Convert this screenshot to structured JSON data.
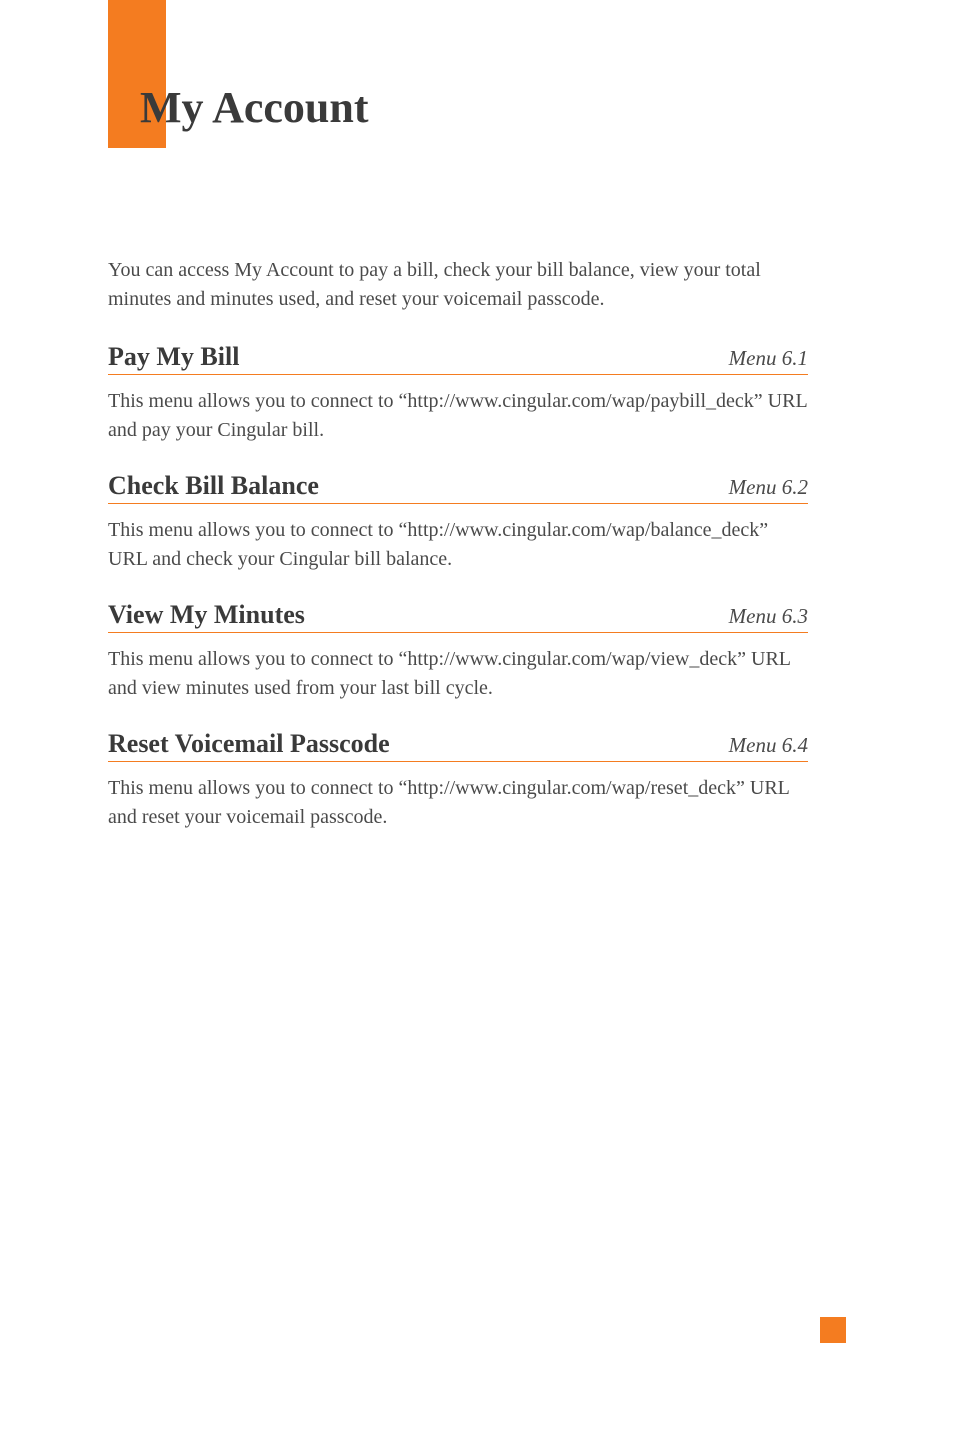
{
  "page_title": "My Account",
  "intro": "You can access My Account to pay a bill, check your bill balance, view your total minutes and minutes used, and reset your voicemail passcode.",
  "sections": [
    {
      "title": "Pay My Bill",
      "menu": "Menu 6.1",
      "body": "This menu allows you to connect to “http://www.cingular.com/wap/paybill_deck” URL and pay your Cingular bill."
    },
    {
      "title": "Check Bill Balance",
      "menu": "Menu 6.2",
      "body": "This menu allows you to connect to “http://www.cingular.com/wap/balance_deck” URL and check your Cingular bill balance."
    },
    {
      "title": "View My Minutes",
      "menu": "Menu 6.3",
      "body": "This menu allows you to connect to “http://www.cingular.com/wap/view_deck” URL and view minutes used from your last bill cycle."
    },
    {
      "title": "Reset Voicemail Passcode",
      "menu": "Menu 6.4",
      "body": "This menu allows you to connect to “http://www.cingular.com/wap/reset_deck” URL and reset your voicemail passcode."
    }
  ]
}
